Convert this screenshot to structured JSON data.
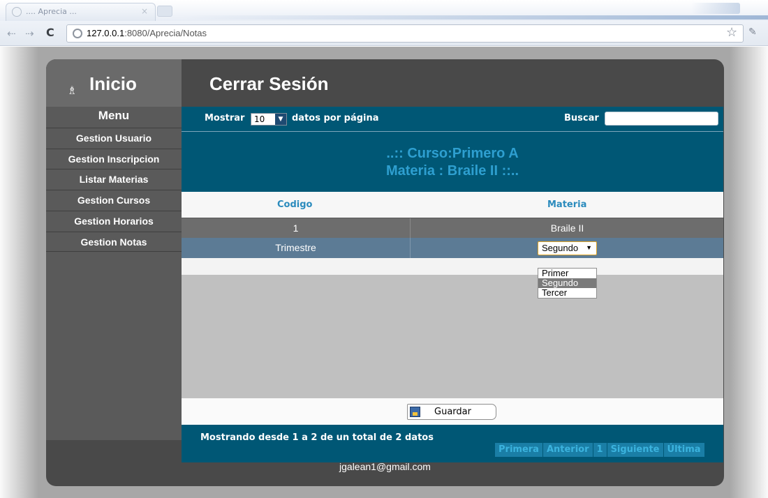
{
  "browser": {
    "tab_title": ".... Aprecia ...",
    "tab_close": "×",
    "url_host": "127.0.0.1",
    "url_rest": ":8080/Aprecia/Notas",
    "icons": {
      "back": "back-arrow-icon",
      "forward": "forward-arrow-icon",
      "reload": "reload-icon",
      "bookmark": "star-icon",
      "settings": "wrench-icon"
    }
  },
  "header": {
    "home_label": "Inicio",
    "home_icon": "♗",
    "logout_label": "Cerrar Sesión"
  },
  "sidebar": {
    "title": "Menu",
    "items": [
      {
        "label": "Gestion Usuario"
      },
      {
        "label": "Gestion Inscripcion"
      },
      {
        "label": "Listar Materias"
      },
      {
        "label": "Gestion Cursos"
      },
      {
        "label": "Gestion Horarios"
      },
      {
        "label": "Gestion Notas"
      }
    ]
  },
  "controls": {
    "show_label": "Mostrar",
    "page_size": "10",
    "per_page_label": "datos por página",
    "search_label": "Buscar",
    "search_value": ""
  },
  "banner": {
    "course_line": "..:: Curso:Primero A",
    "subject_line": "Materia : Braile II ::.."
  },
  "table": {
    "headers": [
      "Codigo",
      "Materia"
    ],
    "rows": [
      {
        "codigo": "1",
        "materia": "Braile II"
      }
    ],
    "trimestre_label": "Trimestre",
    "trimestre_selected": "Segundo",
    "trimestre_options": [
      "Primer",
      "Segundo",
      "Tercer"
    ]
  },
  "actions": {
    "save_label": "Guardar"
  },
  "footer": {
    "info": "Mostrando desde 1 a 2 de un total de 2 datos",
    "pager": [
      "Primera",
      "Anterior",
      "1",
      "Siguiente",
      "Última"
    ],
    "email": "jgalean1@gmail.com"
  },
  "colors": {
    "accent": "#005775",
    "title_blue": "#2e9fd0",
    "sidebar": "#5a5a5a",
    "app_bg": "#494949"
  }
}
